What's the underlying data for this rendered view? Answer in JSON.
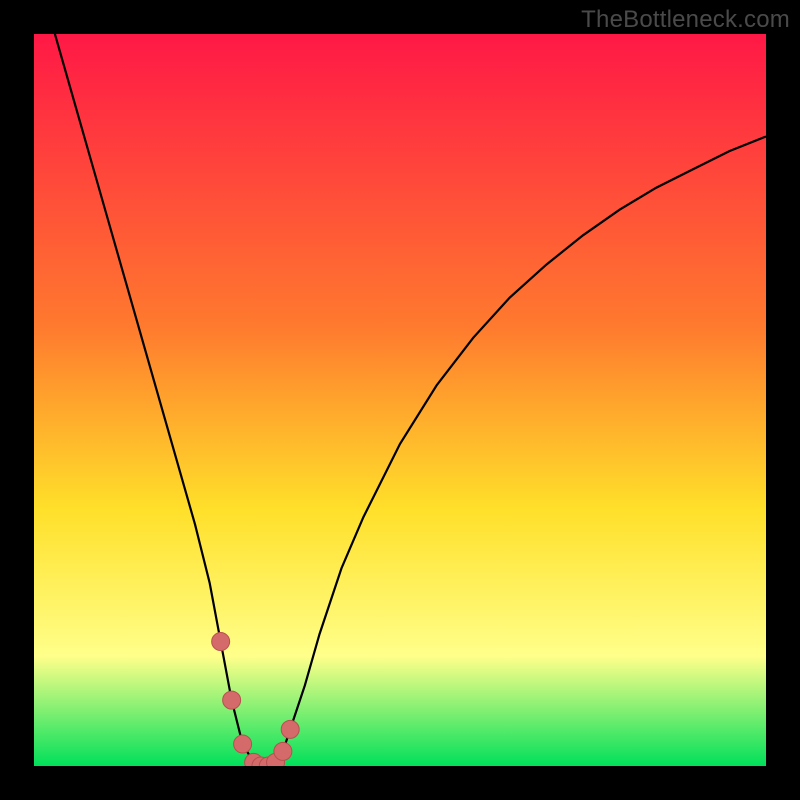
{
  "watermark": "TheBottleneck.com",
  "colors": {
    "bg": "#000000",
    "grad_top": "#ff1846",
    "grad_mid1": "#ff7a2e",
    "grad_mid2": "#ffe02a",
    "grad_mid3": "#ffff8a",
    "grad_bottom": "#00e05a",
    "curve": "#000000",
    "marker_fill": "#d46a6a",
    "marker_stroke": "#b84f4f"
  },
  "chart_data": {
    "type": "line",
    "title": "",
    "xlabel": "",
    "ylabel": "",
    "xlim": [
      0,
      100
    ],
    "ylim": [
      0,
      100
    ],
    "series": [
      {
        "name": "bottleneck-curve",
        "x": [
          0,
          2,
          4,
          6,
          8,
          10,
          12,
          14,
          16,
          18,
          20,
          22,
          24,
          25.5,
          27,
          28.5,
          30,
          31,
          32,
          33,
          34,
          35,
          37,
          39,
          42,
          45,
          50,
          55,
          60,
          65,
          70,
          75,
          80,
          85,
          90,
          95,
          100
        ],
        "values": [
          110,
          103,
          96,
          89,
          82,
          75,
          68,
          61,
          54,
          47,
          40,
          33,
          25,
          17,
          9,
          3,
          0.5,
          0,
          0,
          0.5,
          2,
          5,
          11,
          18,
          27,
          34,
          44,
          52,
          58.5,
          64,
          68.5,
          72.5,
          76,
          79,
          81.5,
          84,
          86
        ]
      }
    ],
    "markers": {
      "name": "optimal-range",
      "x": [
        25.5,
        27,
        28.5,
        30,
        31,
        32,
        33,
        34,
        35
      ],
      "values": [
        17,
        9,
        3,
        0.5,
        0,
        0,
        0.5,
        2,
        5
      ]
    }
  }
}
